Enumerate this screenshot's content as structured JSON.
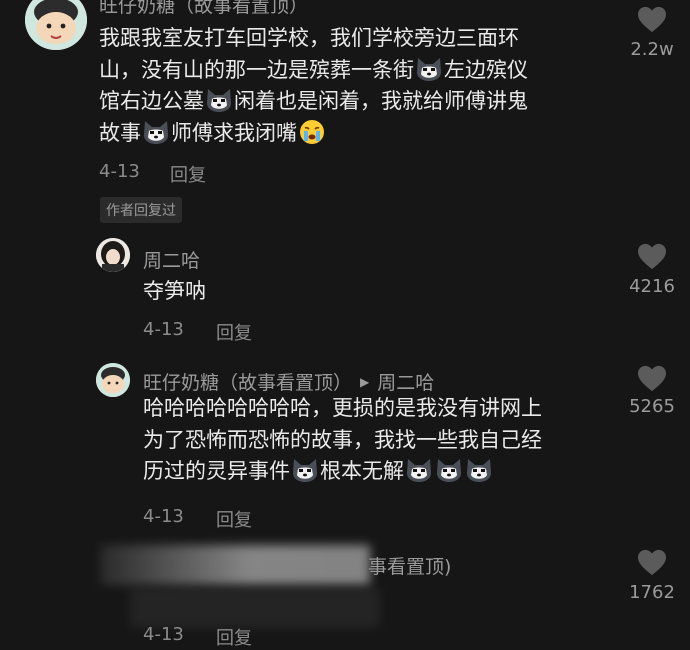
{
  "comments": [
    {
      "author": "旺仔奶糖（故事看置顶）",
      "lines": [
        [
          "我跟我室友打车回学校，我们学校旁边三面环"
        ],
        [
          "山，没有山的那一边是殡葬一条街",
          "{cat}",
          "左边殡仪"
        ],
        [
          "馆右边公墓",
          "{cat}",
          "闲着也是闲着，我就给师傅讲鬼"
        ],
        [
          "故事",
          "{cat}",
          "师傅求我闭嘴",
          "{cry}"
        ]
      ],
      "date": "4-13",
      "reply_label": "回复",
      "author_badge": "作者回复过",
      "likes": "2.2w"
    },
    {
      "author": "周二哈",
      "text": "夺笋呐",
      "date": "4-13",
      "reply_label": "回复",
      "likes": "4216"
    },
    {
      "author": "旺仔奶糖（故事看置顶）",
      "reply_to": "周二哈",
      "text_lines": [
        "哈哈哈哈哈哈哈哈，更损的是我没有讲网上",
        "为了恐怖而恐怖的故事，我找一些我自己经",
        "历过的灵异事件"
      ],
      "tail_text": "根本无解",
      "date": "4-13",
      "reply_label": "回复",
      "likes": "5265"
    },
    {
      "author_partial": "事看置顶)",
      "date": "4-13",
      "reply_label": "回复",
      "likes": "1762"
    }
  ],
  "icons": {
    "like": "heart-icon",
    "emoji_cat": "husky-emoji-icon",
    "emoji_cry": "crying-face-emoji-icon",
    "reply_arrow": "triangle-right-icon"
  },
  "colors": {
    "background": "#161616",
    "text": "#eaeaea",
    "muted": "#8b8b8b",
    "heart": "#5b5b5b"
  }
}
